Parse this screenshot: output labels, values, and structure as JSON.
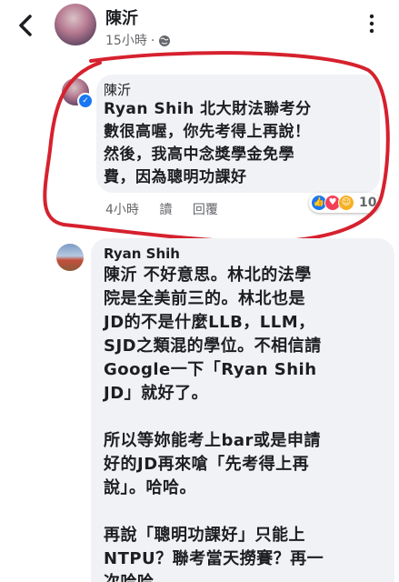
{
  "header": {
    "back_icon": "chevron-left-icon",
    "name": "陳沂",
    "time": "15小時",
    "dot": "·",
    "privacy_icon": "globe-icon",
    "more_icon": "more-dots-icon"
  },
  "comment1": {
    "author": "陳沂",
    "text": "Ryan Shih  北大財法聯考分\n數很高喔，你先考得上再說！\n然後，我高中念獎學金免學\n費，因為聰明功課好",
    "time": "4小時",
    "read_label": "讀",
    "reply_label": "回覆",
    "reaction_count": "10",
    "annotation_color": "#d6212e"
  },
  "comment2": {
    "author": "Ryan Shih",
    "text": "陳沂 不好意思。林北的法學\n院是全美前三的。林北也是\nJD的不是什麼LLB，LLM，\nSJD之類混的學位。不相信請\nGoogle一下「Ryan Shih\nJD」就好了。\n\n所以等妳能考上bar或是申請\n好的JD再來嗆「先考得上再\n說」。哈哈。\n\n再說「聰明功課好」只能上\nNTPU？聯考當天撈賽？再一\n次哈哈。"
  },
  "colors": {
    "bubble": "#f0f2f5",
    "meta_text": "#65676b",
    "like": "#1877f2",
    "love": "#f33e58",
    "haha": "#f7b125"
  }
}
